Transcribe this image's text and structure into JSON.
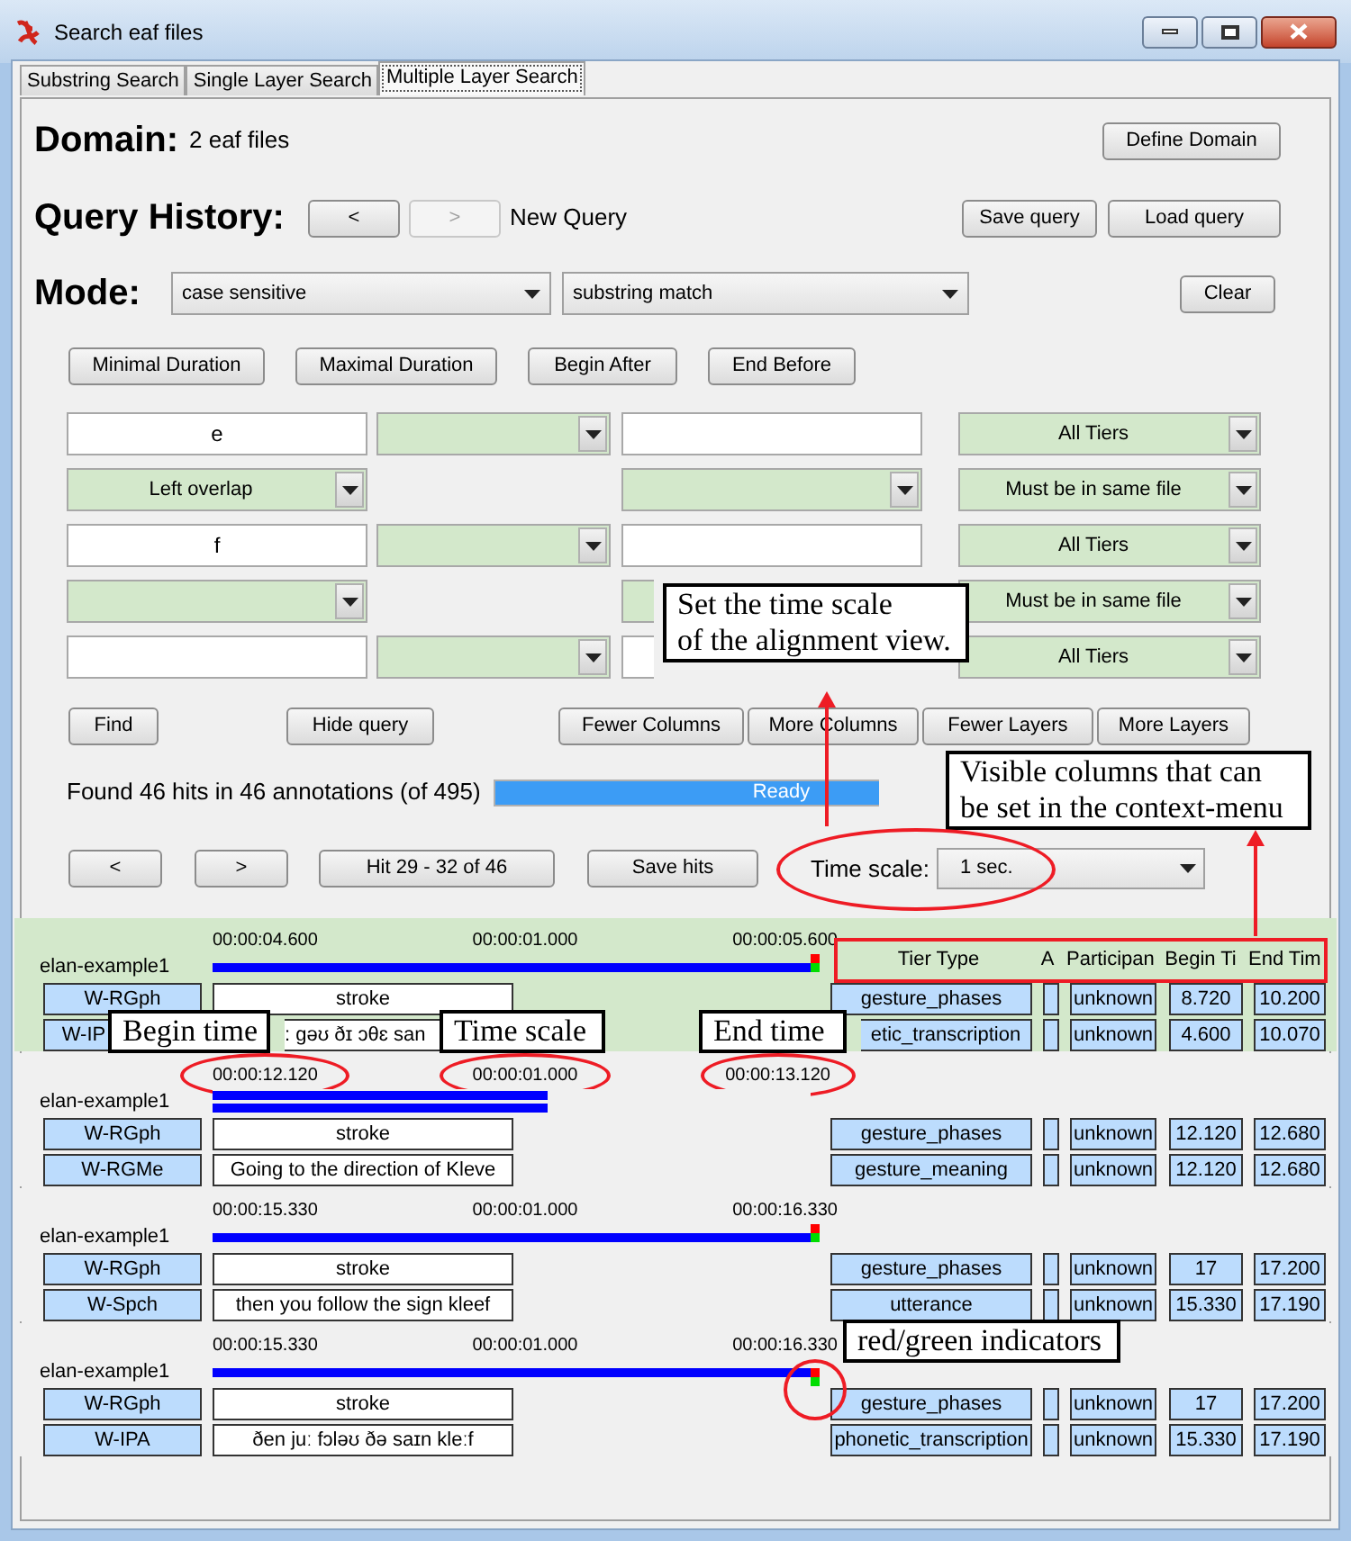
{
  "window": {
    "title": "Search eaf files"
  },
  "tabs": [
    {
      "label": "Substring Search",
      "selected": false
    },
    {
      "label": "Single Layer Search",
      "selected": false
    },
    {
      "label": "Multiple Layer Search",
      "selected": true
    }
  ],
  "domain": {
    "label": "Domain:",
    "value": "2 eaf files",
    "button": "Define Domain"
  },
  "query_history": {
    "label": "Query History:",
    "prev": {
      "label": "<",
      "disabled": false
    },
    "next": {
      "label": ">",
      "disabled": true
    },
    "current": "New Query",
    "buttons": [
      "Save query",
      "Load query"
    ]
  },
  "mode": {
    "label": "Mode:",
    "case": "case sensitive",
    "match": "substring match",
    "clear": "Clear"
  },
  "constraint_buttons": [
    "Minimal Duration",
    "Maximal Duration",
    "Begin After",
    "End Before"
  ],
  "query_rows": [
    {
      "cells": [
        {
          "kind": "text",
          "value": "e"
        },
        {
          "kind": "select"
        },
        {
          "kind": "text"
        },
        {
          "kind": "select",
          "value": "All Tiers"
        }
      ]
    },
    {
      "cells": [
        {
          "kind": "select",
          "value": "Left overlap"
        },
        {
          "kind": "blank"
        },
        {
          "kind": "select"
        },
        {
          "kind": "select",
          "value": "Must be in same file"
        }
      ]
    },
    {
      "cells": [
        {
          "kind": "text",
          "value": "f"
        },
        {
          "kind": "select"
        },
        {
          "kind": "text"
        },
        {
          "kind": "select",
          "value": "All Tiers"
        }
      ]
    },
    {
      "cells": [
        {
          "kind": "select"
        },
        {
          "kind": "blank"
        },
        {
          "kind": "select"
        },
        {
          "kind": "select",
          "value": "Must be in same file"
        }
      ]
    },
    {
      "cells": [
        {
          "kind": "text"
        },
        {
          "kind": "select"
        },
        {
          "kind": "text"
        },
        {
          "kind": "select",
          "value": "All Tiers"
        }
      ]
    }
  ],
  "actions": [
    "Find",
    "Hide query"
  ],
  "layout_buttons": [
    "Fewer Columns",
    "More Columns",
    "Fewer Layers",
    "More Layers"
  ],
  "status": {
    "text": "Found 46 hits in 46 annotations (of 495)",
    "progress": {
      "label": "Ready",
      "level": 1
    }
  },
  "navigation": {
    "prev": "<",
    "next": ">",
    "hits": "Hit 29 - 32 of 46",
    "save": "Save hits",
    "time_scale_label": "Time scale:",
    "time_scale": "1 sec."
  },
  "columns": [
    "Tier Type",
    "A",
    "Participan",
    "Begin Ti",
    "End Tim"
  ],
  "results": [
    {
      "file": "elan-example1",
      "highlighted": true,
      "begin": "00:00:04.600",
      "scale": "00:00:01.000",
      "end": "00:00:05.600",
      "indicators": true,
      "bars": [
        {
          "level": 1
        }
      ],
      "rows": [
        {
          "tier": "W-RGph",
          "annotation": "stroke",
          "tier_type": "gesture_phases",
          "participant": "unknown",
          "begin": "8.720",
          "end": "10.200"
        },
        {
          "tier": "W-IP",
          "annotation": ": gəʊ ðɪ ɔθɛ san",
          "tier_type": "etic_transcription",
          "participant": "unknown",
          "begin": "4.600",
          "end": "10.070"
        }
      ]
    },
    {
      "file": "elan-example1",
      "highlighted": false,
      "begin": "00:00:12.120",
      "scale": "00:00:01.000",
      "end": "00:00:13.120",
      "indicators": false,
      "bars": [
        {
          "level": 0.56
        },
        {
          "level": 0.56
        }
      ],
      "rows": [
        {
          "tier": "W-RGph",
          "annotation": "stroke",
          "tier_type": "gesture_phases",
          "participant": "unknown",
          "begin": "12.120",
          "end": "12.680"
        },
        {
          "tier": "W-RGMe",
          "annotation": "Going to the direction of Kleve",
          "tier_type": "gesture_meaning",
          "participant": "unknown",
          "begin": "12.120",
          "end": "12.680"
        }
      ]
    },
    {
      "file": "elan-example1",
      "highlighted": false,
      "begin": "00:00:15.330",
      "scale": "00:00:01.000",
      "end": "00:00:16.330",
      "indicators": true,
      "bars": [
        {
          "level": 1
        }
      ],
      "rows": [
        {
          "tier": "W-RGph",
          "annotation": "stroke",
          "tier_type": "gesture_phases",
          "participant": "unknown",
          "begin": "17",
          "end": "17.200"
        },
        {
          "tier": "W-Spch",
          "annotation": "then you follow the sign kleef",
          "tier_type": "utterance",
          "participant": "unknown",
          "begin": "15.330",
          "end": "17.190"
        }
      ]
    },
    {
      "file": "elan-example1",
      "highlighted": false,
      "begin": "00:00:15.330",
      "scale": "00:00:01.000",
      "end": "00:00:16.330",
      "indicators": true,
      "bars": [
        {
          "level": 1
        }
      ],
      "rows": [
        {
          "tier": "W-RGph",
          "annotation": "stroke",
          "tier_type": "gesture_phases",
          "participant": "unknown",
          "begin": "17",
          "end": "17.200"
        },
        {
          "tier": "W-IPA",
          "annotation": "ðen juː fɔləʊ ðə saɪn kleːf",
          "tier_type": "phonetic_transcription",
          "participant": "unknown",
          "begin": "15.330",
          "end": "17.190"
        }
      ]
    }
  ],
  "callouts": [
    {
      "lines": [
        "Set the time scale",
        "of the alignment view."
      ]
    },
    {
      "lines": [
        "Visible columns that can",
        "be set in the context-menu"
      ]
    },
    {
      "lines": [
        "Begin time"
      ]
    },
    {
      "lines": [
        "Time scale"
      ]
    },
    {
      "lines": [
        "End time"
      ]
    },
    {
      "lines": [
        "red/green indicators"
      ]
    }
  ]
}
